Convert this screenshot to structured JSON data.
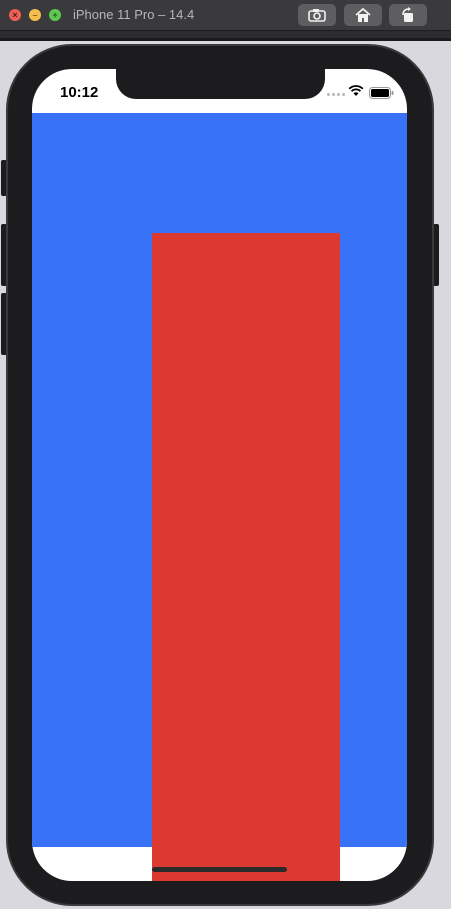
{
  "window": {
    "title": "iPhone 11 Pro – 14.4",
    "controls": [
      "close",
      "minimize",
      "zoom"
    ],
    "toolbar_buttons": [
      "screenshot",
      "home",
      "rotate"
    ]
  },
  "status_bar": {
    "time": "10:12"
  },
  "colors": {
    "blue_view": "#3872f7",
    "red_view": "#dc3930",
    "screen_background": "#ffffff"
  }
}
